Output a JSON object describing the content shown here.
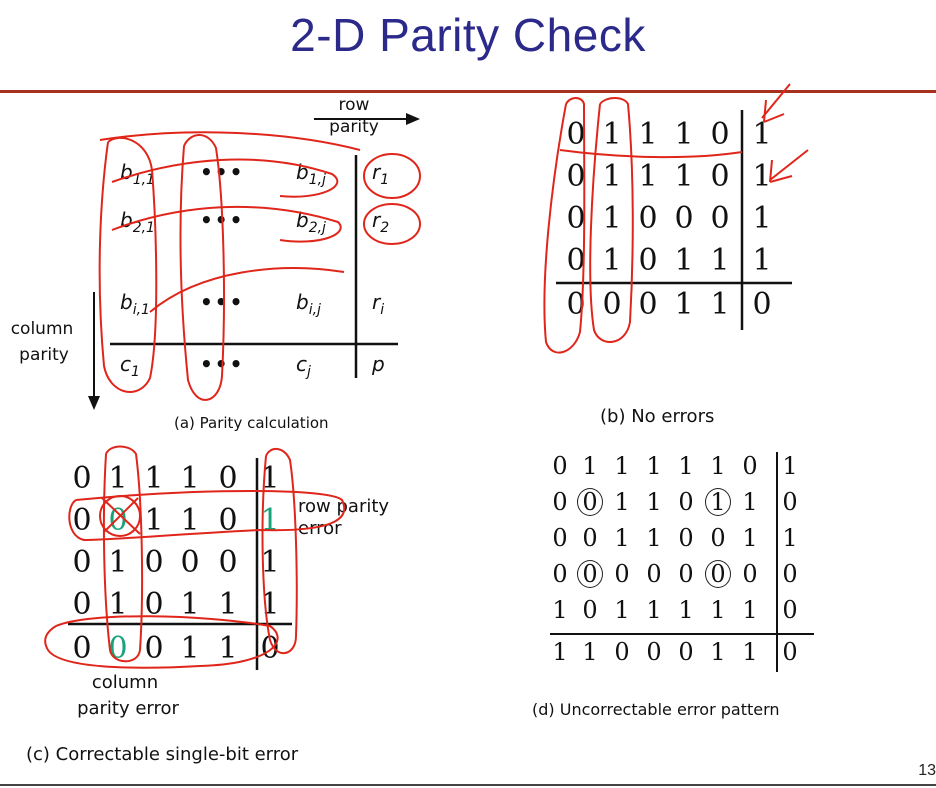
{
  "title": "2-D Parity Check",
  "page_number": "13",
  "panel_a": {
    "row_parity_label": [
      "row",
      "parity"
    ],
    "column_parity_label": [
      "column",
      "parity"
    ],
    "cells": [
      {
        "base": "b",
        "sub": "1,1"
      },
      {
        "dots": "•••"
      },
      {
        "base": "b",
        "sub": "1,j"
      },
      {
        "base": "r",
        "sub": "1"
      },
      {
        "base": "b",
        "sub": "2,1"
      },
      {
        "dots": "•••"
      },
      {
        "base": "b",
        "sub": "2,j"
      },
      {
        "base": "r",
        "sub": "2"
      },
      {
        "base": "b",
        "sub": "i,1"
      },
      {
        "dots": "•••"
      },
      {
        "base": "b",
        "sub": "i,j"
      },
      {
        "base": "r",
        "sub": "i"
      },
      {
        "base": "c",
        "sub": "1"
      },
      {
        "dots": "•••"
      },
      {
        "base": "c",
        "sub": "j"
      },
      {
        "base": "p",
        "sub": ""
      }
    ],
    "caption": "(a) Parity calculation"
  },
  "panel_b": {
    "rows": [
      [
        "0",
        "1",
        "1",
        "1",
        "0",
        "1"
      ],
      [
        "0",
        "1",
        "1",
        "1",
        "0",
        "1"
      ],
      [
        "0",
        "1",
        "0",
        "0",
        "0",
        "1"
      ],
      [
        "0",
        "1",
        "0",
        "1",
        "1",
        "1"
      ],
      [
        "0",
        "0",
        "0",
        "1",
        "1",
        "0"
      ]
    ],
    "caption": "(b) No errors"
  },
  "panel_c": {
    "rows": [
      [
        "0",
        "1",
        "1",
        "1",
        "0",
        "1"
      ],
      [
        "0",
        "0",
        "1",
        "1",
        "0",
        "1"
      ],
      [
        "0",
        "1",
        "0",
        "0",
        "0",
        "1"
      ],
      [
        "0",
        "1",
        "0",
        "1",
        "1",
        "1"
      ],
      [
        "0",
        "0",
        "0",
        "1",
        "1",
        "0"
      ]
    ],
    "row_parity_error_label": "row parity error",
    "row_parity_error_words": [
      "row",
      "parity",
      "error"
    ],
    "column_parity_error_label": [
      "column",
      "parity error"
    ],
    "caption": "(c) Correctable single-bit error"
  },
  "panel_d": {
    "rows": [
      [
        "0",
        "1",
        "1",
        "1",
        "1",
        "1",
        "0",
        "1"
      ],
      [
        "0",
        "0",
        "1",
        "1",
        "0",
        "1",
        "1",
        "0"
      ],
      [
        "0",
        "0",
        "1",
        "1",
        "0",
        "0",
        "1",
        "1"
      ],
      [
        "0",
        "0",
        "0",
        "0",
        "0",
        "0",
        "0",
        "0"
      ],
      [
        "1",
        "0",
        "1",
        "1",
        "1",
        "1",
        "1",
        "0"
      ],
      [
        "1",
        "1",
        "0",
        "0",
        "0",
        "1",
        "1",
        "0"
      ]
    ],
    "circled": [
      [
        1,
        1
      ],
      [
        1,
        5
      ],
      [
        3,
        1
      ],
      [
        3,
        5
      ]
    ],
    "caption": "(d) Uncorrectable error pattern"
  },
  "colors": {
    "title": "#2b2a8a",
    "annotation": "#e0261b",
    "highlight": "#1aa37a",
    "rule": "#a8301e"
  }
}
